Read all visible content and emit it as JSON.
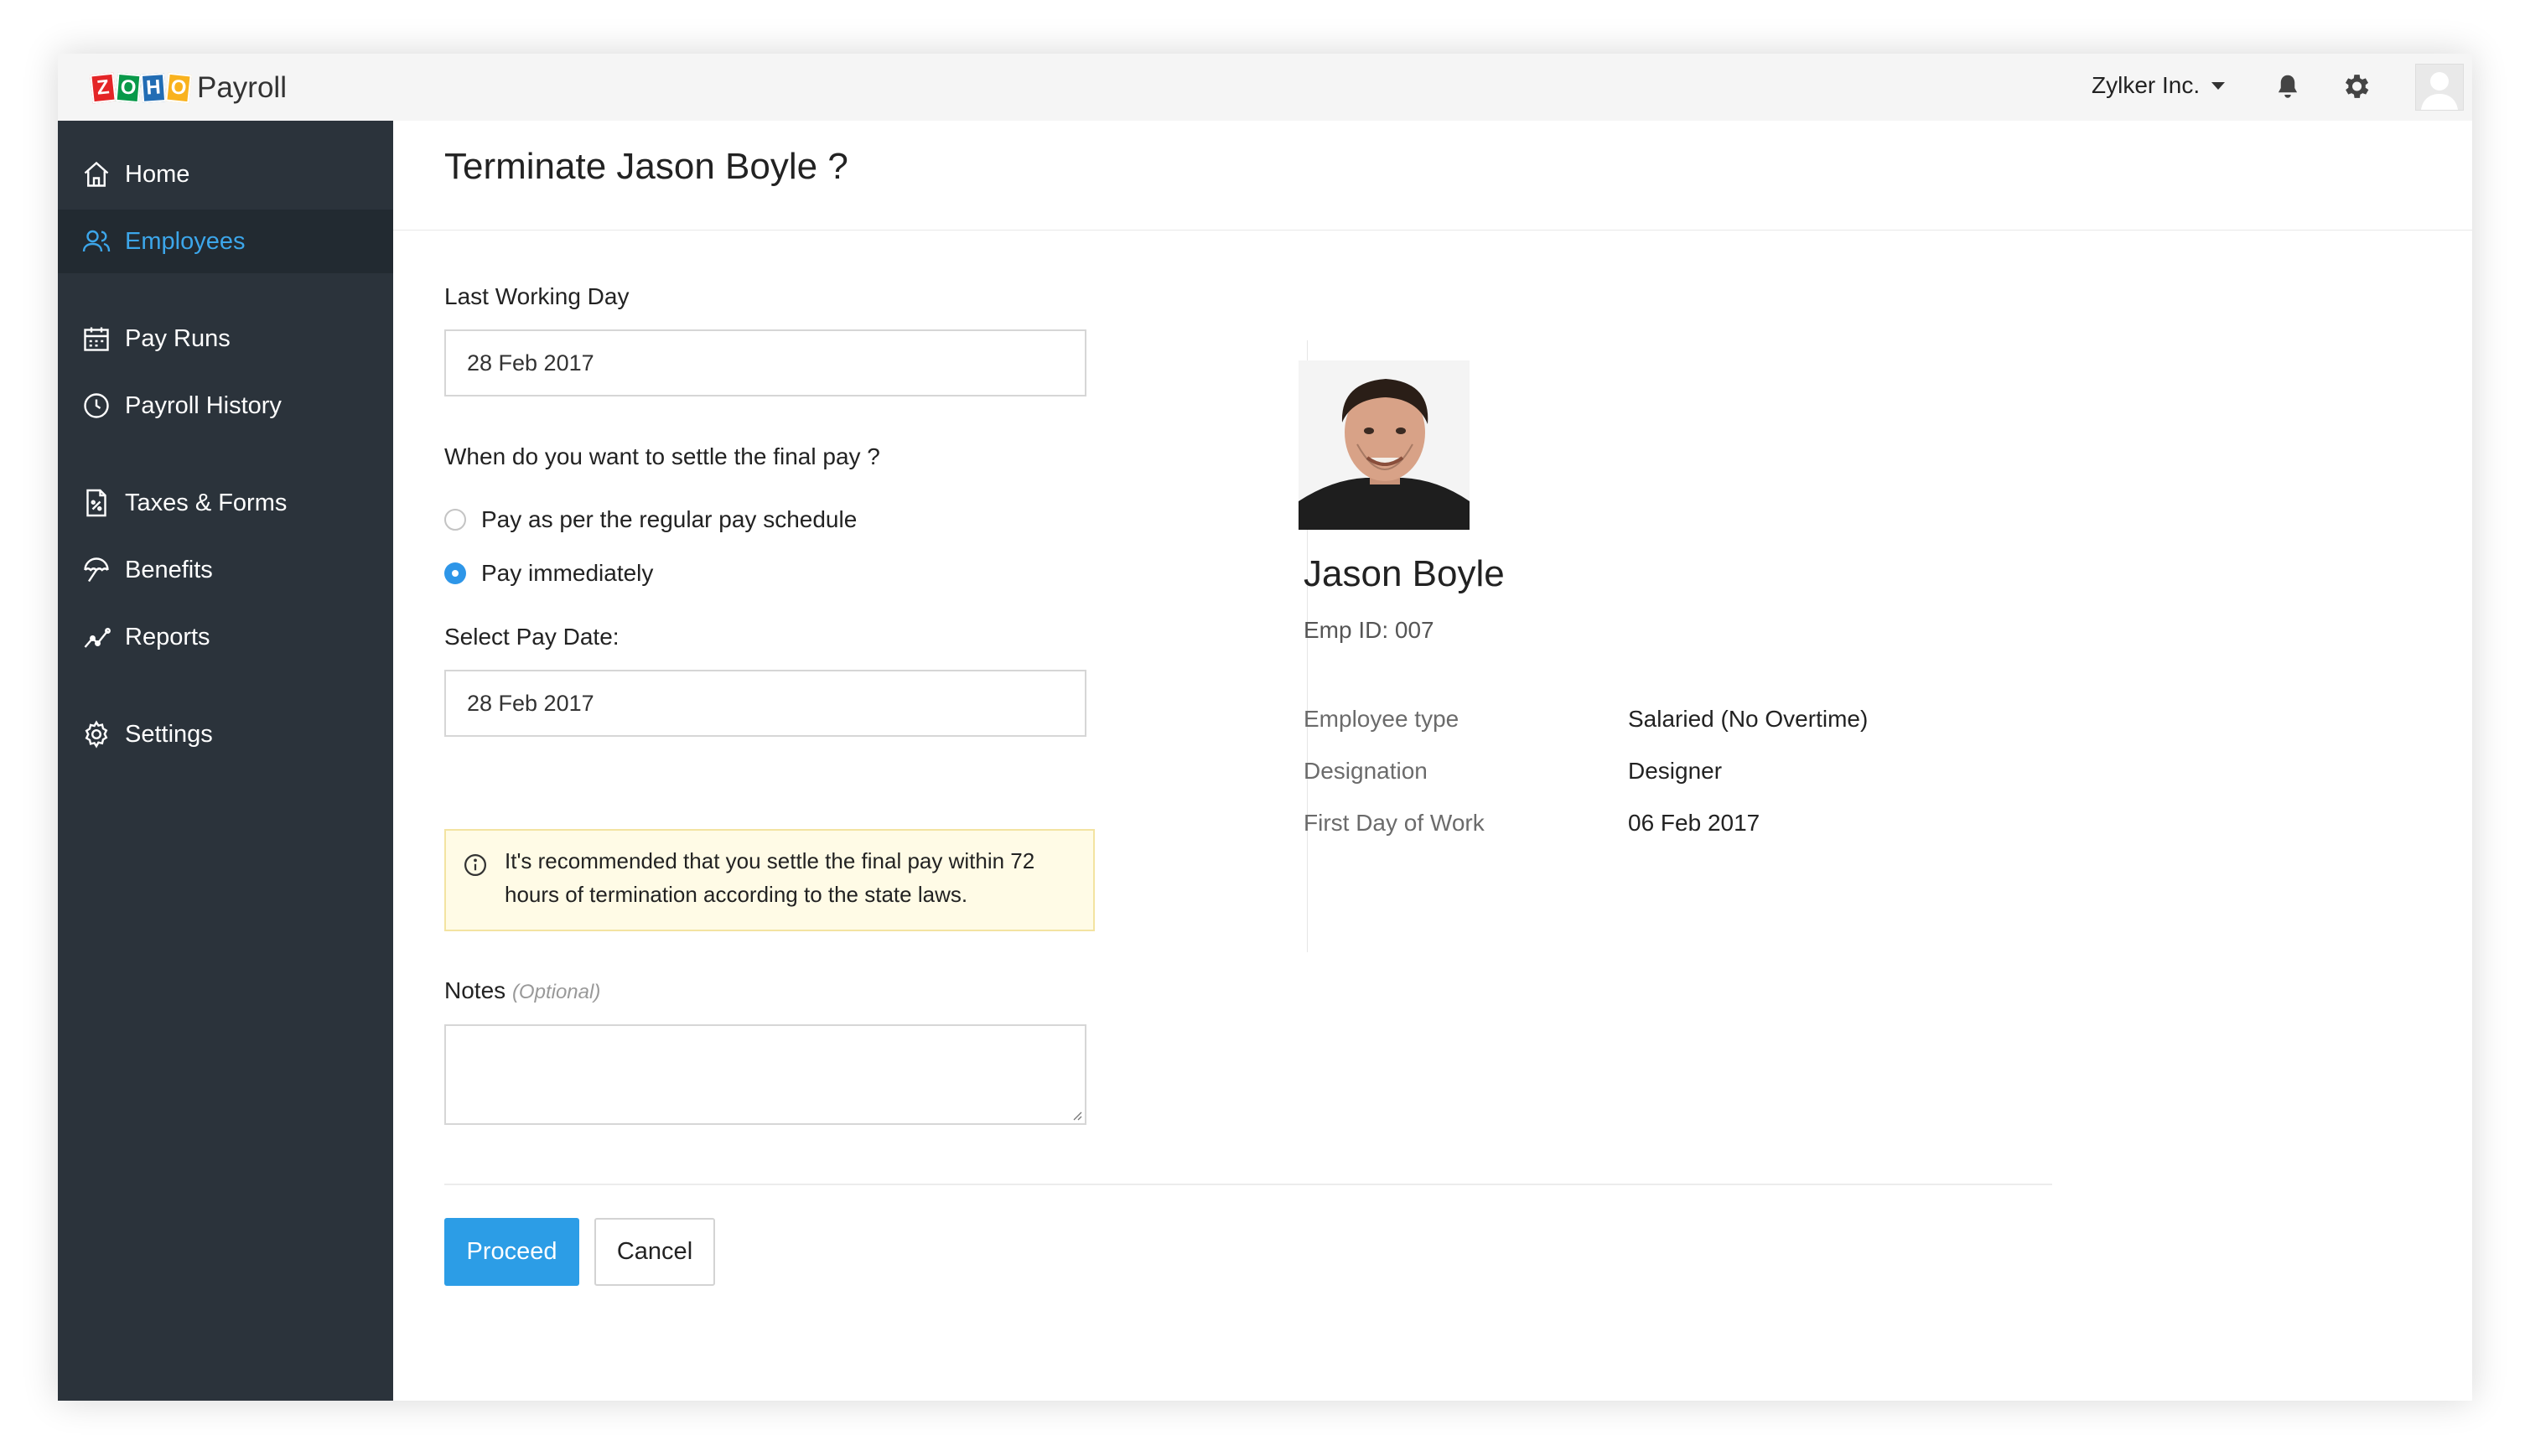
{
  "app": {
    "logo_letters": [
      "Z",
      "O",
      "H",
      "O"
    ],
    "name": "Payroll"
  },
  "topbar": {
    "org_name": "Zylker Inc.",
    "icons": [
      "bell-icon",
      "gear-icon",
      "avatar"
    ]
  },
  "sidebar": {
    "items": [
      {
        "label": "Home",
        "icon": "home-icon"
      },
      {
        "label": "Employees",
        "icon": "users-icon",
        "active": true
      },
      {
        "label": "Pay Runs",
        "icon": "calendar-icon"
      },
      {
        "label": "Payroll History",
        "icon": "clock-icon"
      },
      {
        "label": "Taxes & Forms",
        "icon": "tax-document-icon"
      },
      {
        "label": "Benefits",
        "icon": "umbrella-icon"
      },
      {
        "label": "Reports",
        "icon": "chart-icon"
      },
      {
        "label": "Settings",
        "icon": "gear-icon"
      }
    ]
  },
  "form": {
    "title": "Terminate Jason Boyle ?",
    "last_working_day_label": "Last Working Day",
    "last_working_day_value": "28 Feb 2017",
    "settle_question": "When do you want to settle the final pay ?",
    "options": [
      {
        "label": "Pay as per the regular pay schedule",
        "checked": false
      },
      {
        "label": "Pay immediately",
        "checked": true
      }
    ],
    "pay_date_label": "Select Pay Date:",
    "pay_date_value": "28 Feb 2017",
    "alert_text": "It's recommended that you settle the final pay within 72 hours of termination according to the state laws.",
    "notes_label": "Notes",
    "notes_optional": "(Optional)",
    "notes_value": "",
    "proceed_label": "Proceed",
    "cancel_label": "Cancel"
  },
  "employee": {
    "name": "Jason Boyle",
    "emp_id": "Emp ID: 007",
    "details": [
      {
        "label": "Employee type",
        "value": "Salaried (No Overtime)"
      },
      {
        "label": "Designation",
        "value": "Designer"
      },
      {
        "label": "First Day of Work",
        "value": "06 Feb 2017"
      }
    ]
  },
  "colors": {
    "sidebar_bg": "#2b333b",
    "accent": "#2c9de6",
    "active_text": "#3ca6ea",
    "alert_bg": "#fffbe6"
  }
}
